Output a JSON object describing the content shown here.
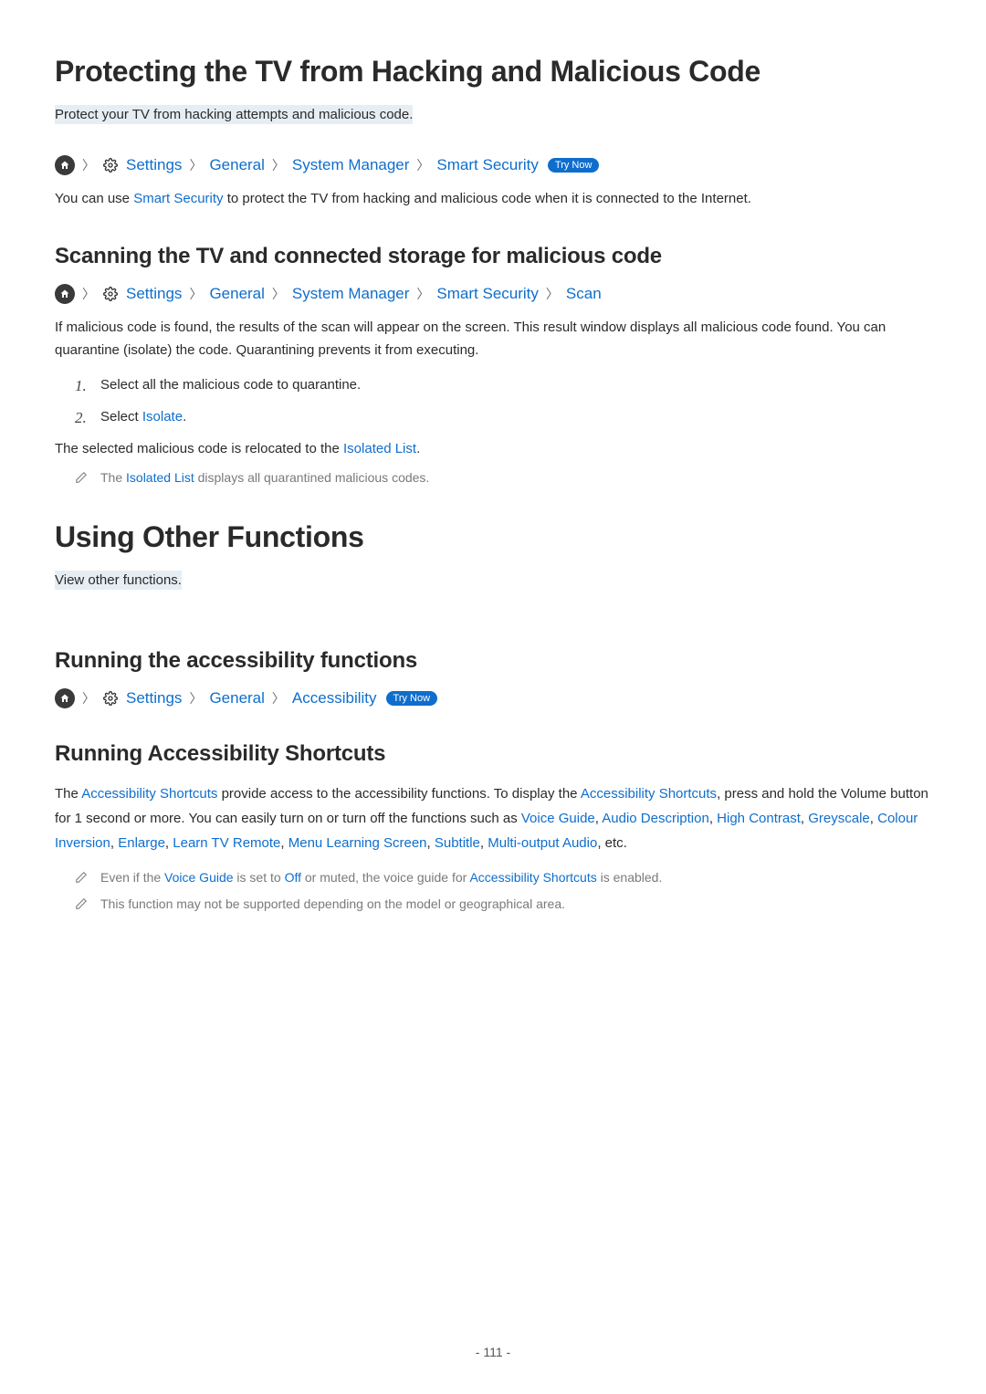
{
  "colors": {
    "link": "#0f6ecd"
  },
  "section1": {
    "title": "Protecting the TV from Hacking and Malicious Code",
    "subtitle": "Protect your TV from hacking attempts and malicious code.",
    "breadcrumb": {
      "settings": "Settings",
      "general": "General",
      "system_manager": "System Manager",
      "smart_security": "Smart Security",
      "try_now": "Try Now"
    },
    "desc_prefix": "You can use ",
    "desc_link": "Smart Security",
    "desc_suffix": " to protect the TV from hacking and malicious code when it is connected to the Internet."
  },
  "section2": {
    "heading": "Scanning the TV and connected storage for malicious code",
    "breadcrumb": {
      "settings": "Settings",
      "general": "General",
      "system_manager": "System Manager",
      "smart_security": "Smart Security",
      "scan": "Scan"
    },
    "para": "If malicious code is found, the results of the scan will appear on the screen. This result window displays all malicious code found. You can quarantine (isolate) the code. Quarantining prevents it from executing.",
    "step1": "Select all the malicious code to quarantine.",
    "step2_prefix": "Select ",
    "step2_link": "Isolate",
    "step2_suffix": ".",
    "result_prefix": "The selected malicious code is relocated to the ",
    "result_link": "Isolated List",
    "result_suffix": ".",
    "note_prefix": "The ",
    "note_link": "Isolated List",
    "note_suffix": " displays all quarantined malicious codes."
  },
  "section3": {
    "title": "Using Other Functions",
    "subtitle": "View other functions."
  },
  "section4": {
    "heading": "Running the accessibility functions",
    "breadcrumb": {
      "settings": "Settings",
      "general": "General",
      "accessibility": "Accessibility",
      "try_now": "Try Now"
    }
  },
  "section5": {
    "heading": "Running Accessibility Shortcuts",
    "p_parts": {
      "t1": "The ",
      "l1": "Accessibility Shortcuts",
      "t2": " provide access to the accessibility functions. To display the ",
      "l2": "Accessibility Shortcuts",
      "t3": ", press and hold the Volume button for 1 second or more. You can easily turn on or turn off the functions such as ",
      "l3": "Voice Guide",
      "c1": ", ",
      "l4": "Audio Description",
      "c2": ", ",
      "l5": "High Contrast",
      "c3": ", ",
      "l6": "Greyscale",
      "c4": ", ",
      "l7": "Colour Inversion",
      "c5": ", ",
      "l8": "Enlarge",
      "c6": ", ",
      "l9": "Learn TV Remote",
      "c7": ", ",
      "l10": "Menu Learning Screen",
      "c8": ", ",
      "l11": "Subtitle",
      "c9": ", ",
      "l12": "Multi-output Audio",
      "t4": ", etc."
    },
    "note1": {
      "t1": "Even if the ",
      "l1": "Voice Guide",
      "t2": " is set to ",
      "l2": "Off",
      "t3": " or muted, the voice guide for ",
      "l3": "Accessibility Shortcuts",
      "t4": " is enabled."
    },
    "note2": "This function may not be supported depending on the model or geographical area."
  },
  "page_number": "- 111 -"
}
